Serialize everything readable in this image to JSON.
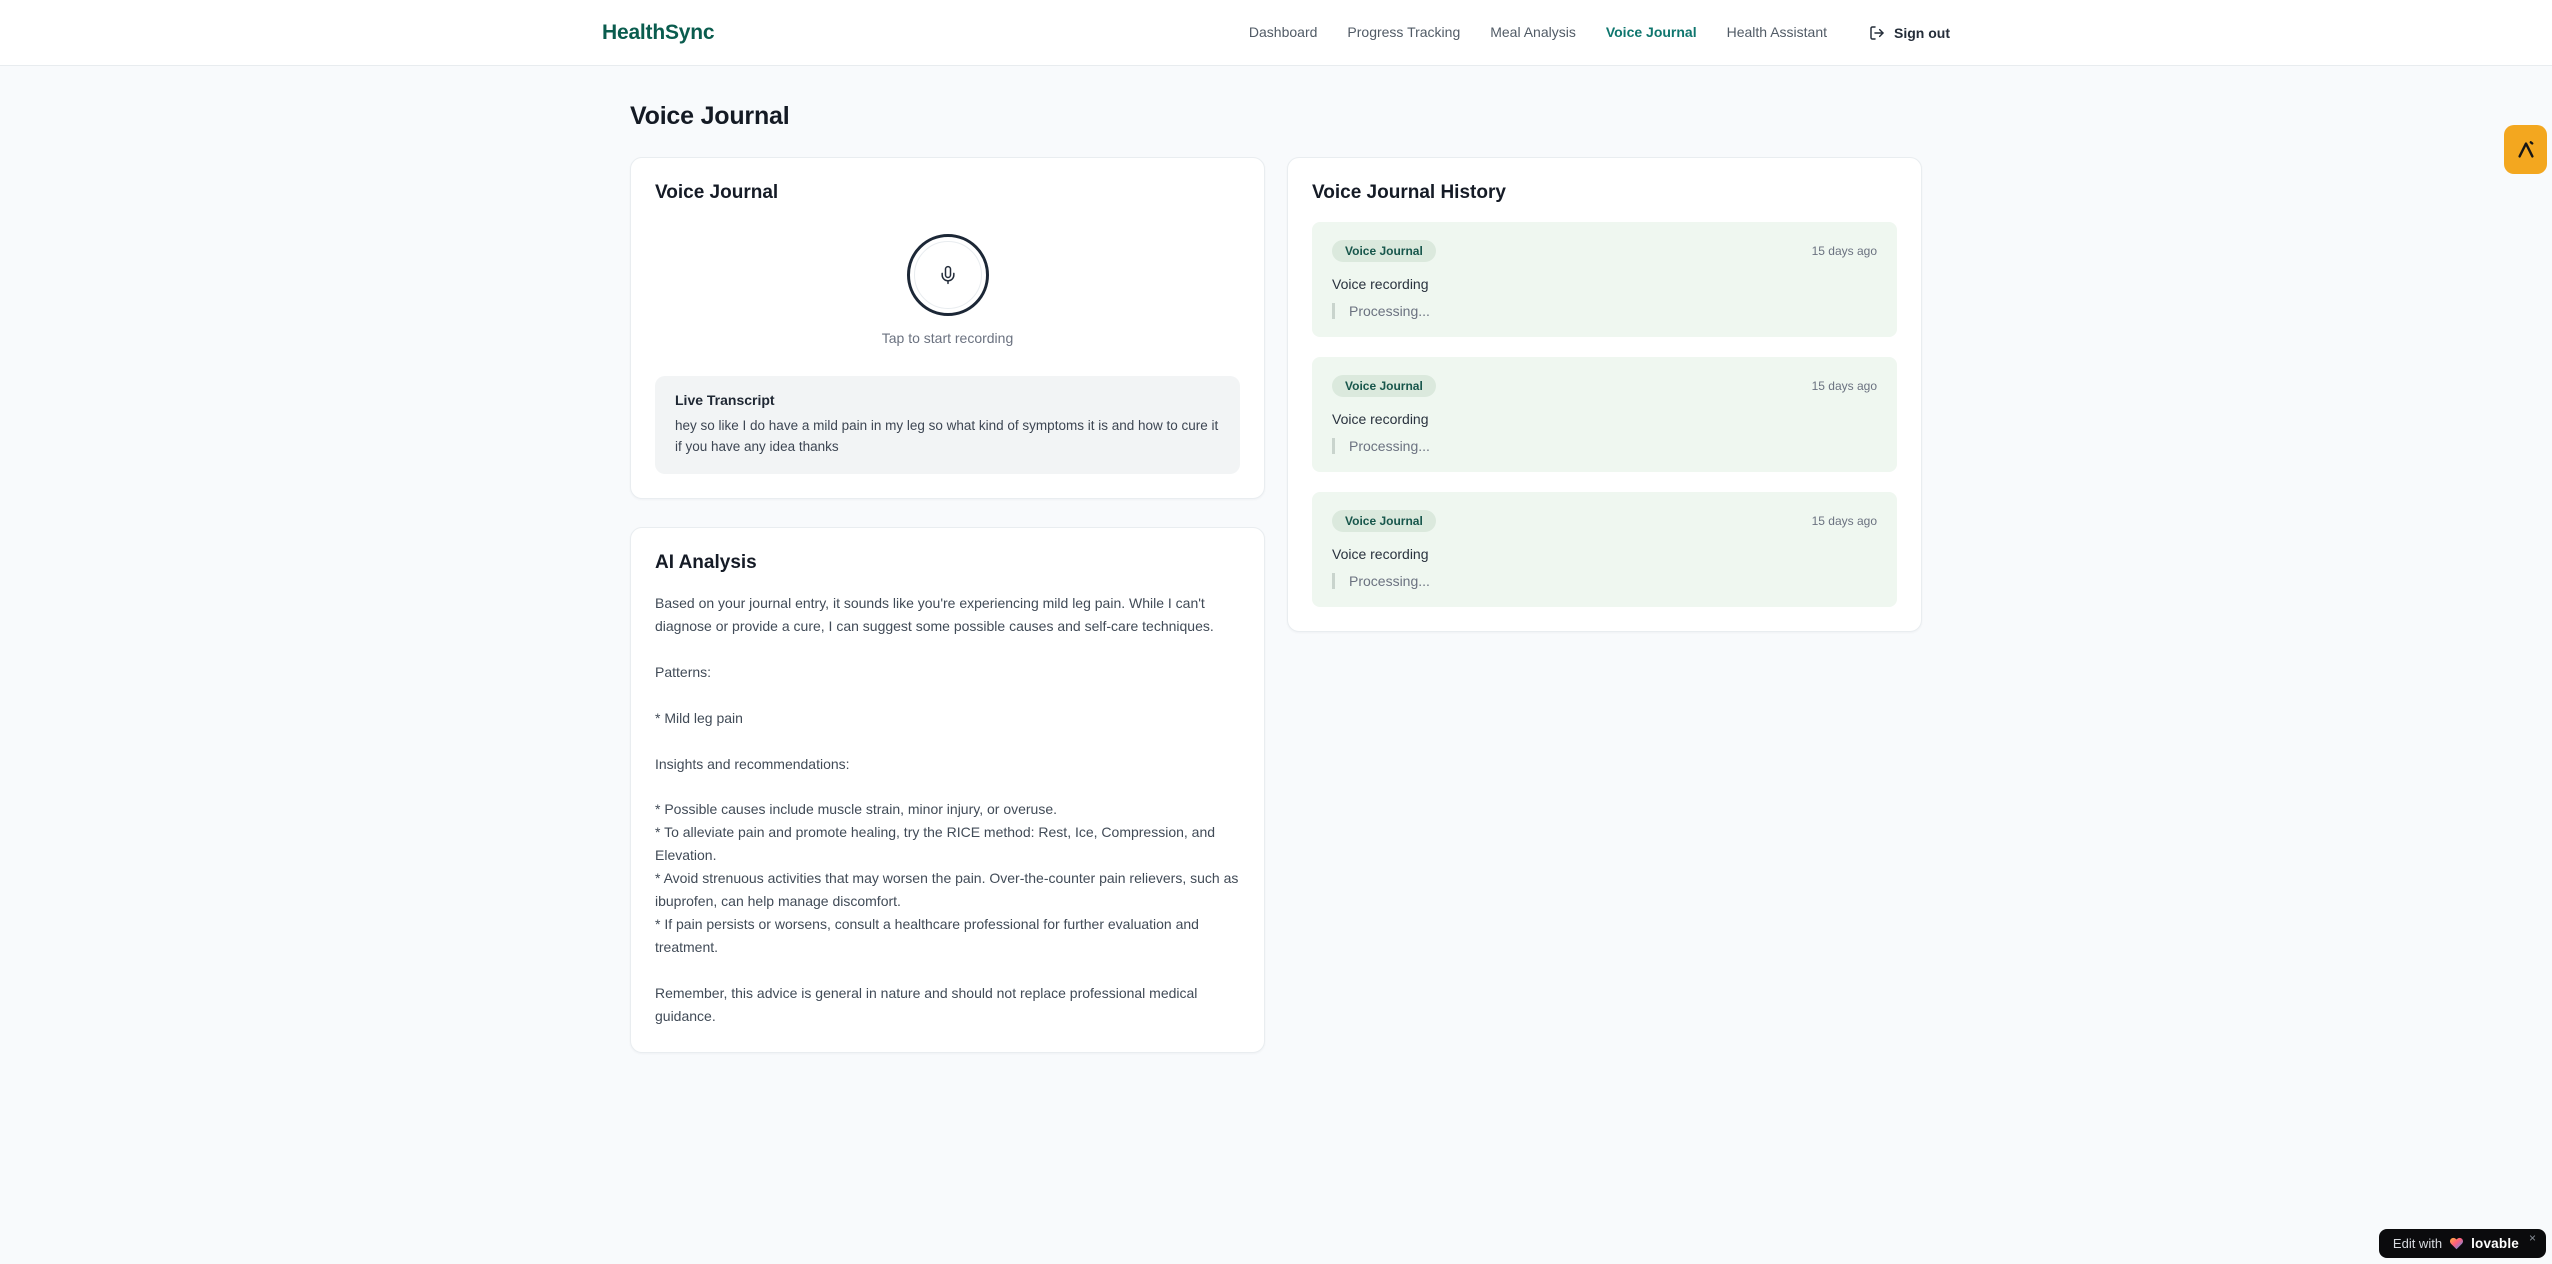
{
  "brand": {
    "name": "HealthSync"
  },
  "nav": {
    "items": [
      {
        "label": "Dashboard",
        "active": false
      },
      {
        "label": "Progress Tracking",
        "active": false
      },
      {
        "label": "Meal Analysis",
        "active": false
      },
      {
        "label": "Voice Journal",
        "active": true
      },
      {
        "label": "Health Assistant",
        "active": false
      }
    ],
    "signout_label": "Sign out"
  },
  "page": {
    "title": "Voice Journal"
  },
  "recorder": {
    "card_title": "Voice Journal",
    "mic_hint": "Tap to start recording",
    "transcript_title": "Live Transcript",
    "transcript_text": "hey so like I do have a mild pain in my leg so what kind of symptoms it is and how to cure it if you have any idea thanks"
  },
  "analysis": {
    "card_title": "AI Analysis",
    "body": "Based on your journal entry, it sounds like you're experiencing mild leg pain. While I can't diagnose or provide a cure, I can suggest some possible causes and self-care techniques.\n\nPatterns:\n\n* Mild leg pain\n\nInsights and recommendations:\n\n* Possible causes include muscle strain, minor injury, or overuse.\n* To alleviate pain and promote healing, try the RICE method: Rest, Ice, Compression, and Elevation.\n* Avoid strenuous activities that may worsen the pain. Over-the-counter pain relievers, such as ibuprofen, can help manage discomfort.\n* If pain persists or worsens, consult a healthcare professional for further evaluation and treatment.\n\nRemember, this advice is general in nature and should not replace professional medical guidance."
  },
  "history": {
    "card_title": "Voice Journal History",
    "entries": [
      {
        "badge": "Voice Journal",
        "time": "15 days ago",
        "title": "Voice recording",
        "status": "Processing..."
      },
      {
        "badge": "Voice Journal",
        "time": "15 days ago",
        "title": "Voice recording",
        "status": "Processing..."
      },
      {
        "badge": "Voice Journal",
        "time": "15 days ago",
        "title": "Voice recording",
        "status": "Processing..."
      }
    ]
  },
  "badges": {
    "edit_label": "Edit with",
    "brand_label": "lovable",
    "close_glyph": "×"
  },
  "colors": {
    "brand_teal": "#0a5c4e",
    "accent_teal": "#0f766e",
    "amber_badge": "#f3a71f",
    "history_entry_bg": "#eff7f0",
    "badge_pill_bg": "#dbe9dd"
  }
}
